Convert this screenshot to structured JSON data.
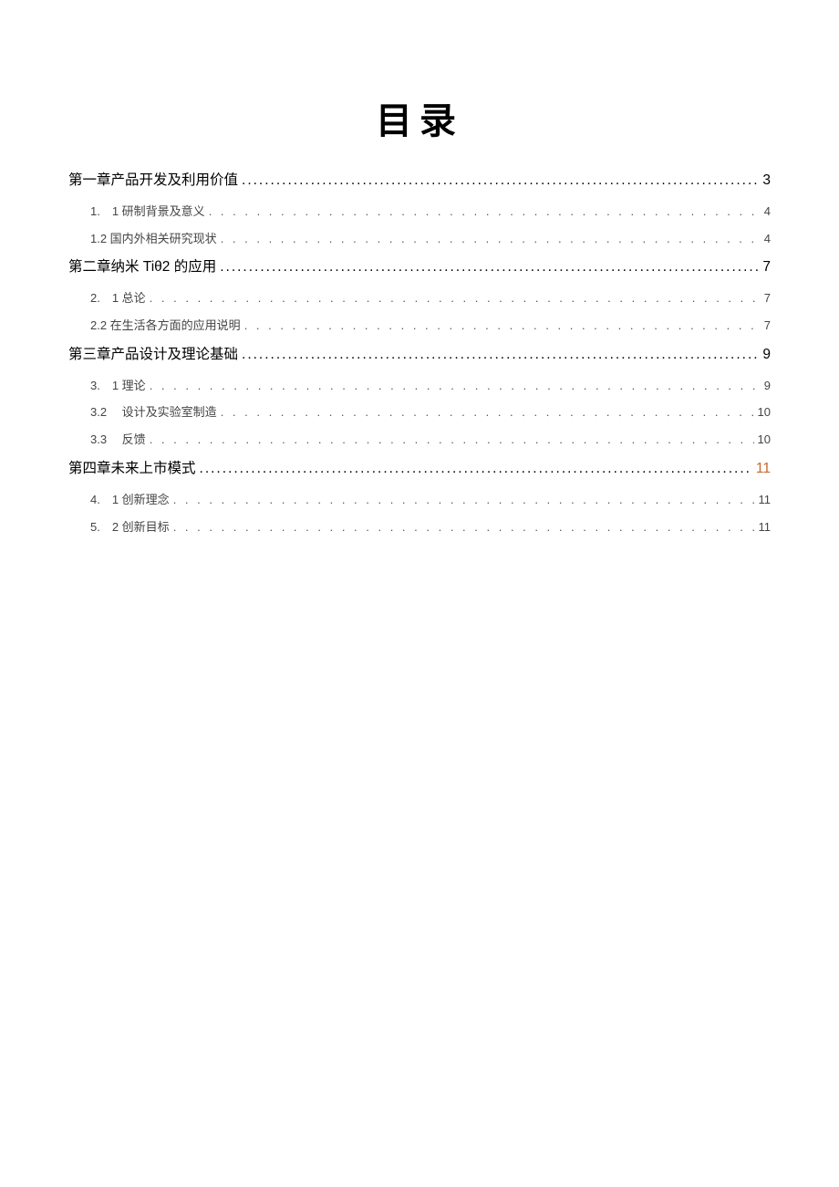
{
  "title": "目录",
  "entries": [
    {
      "level": 1,
      "label": "第一章产品开发及利用价值",
      "page": "3",
      "accent": false
    },
    {
      "level": 2,
      "label": "1.　1 研制背景及意义",
      "page": "4",
      "accent": false
    },
    {
      "level": 2,
      "label": "1.2 国内外相关研究现状",
      "page": "4",
      "accent": false
    },
    {
      "level": 1,
      "label": "第二章纳米 Tiθ2 的应用",
      "page": "7",
      "accent": false
    },
    {
      "level": 2,
      "label": "2.　1 总论",
      "page": "7",
      "accent": false
    },
    {
      "level": 2,
      "label": "2.2 在生活各方面的应用说明",
      "page": "7",
      "accent": false
    },
    {
      "level": 1,
      "label": "第三章产品设计及理论基础",
      "page": "9",
      "accent": false
    },
    {
      "level": 2,
      "label": "3.　1 理论",
      "page": "9",
      "accent": false
    },
    {
      "level": 2,
      "label": "3.2　 设计及实验室制造",
      "page": "10",
      "accent": false
    },
    {
      "level": 2,
      "label": "3.3　 反馈",
      "page": "10",
      "accent": false
    },
    {
      "level": 1,
      "label": "第四章未来上市模式",
      "page": "11",
      "accent": true
    },
    {
      "level": 2,
      "label": "4.　1 创新理念",
      "page": "11",
      "accent": false
    },
    {
      "level": 2,
      "label": "5.　2 创新目标",
      "page": "11",
      "accent": false
    }
  ]
}
